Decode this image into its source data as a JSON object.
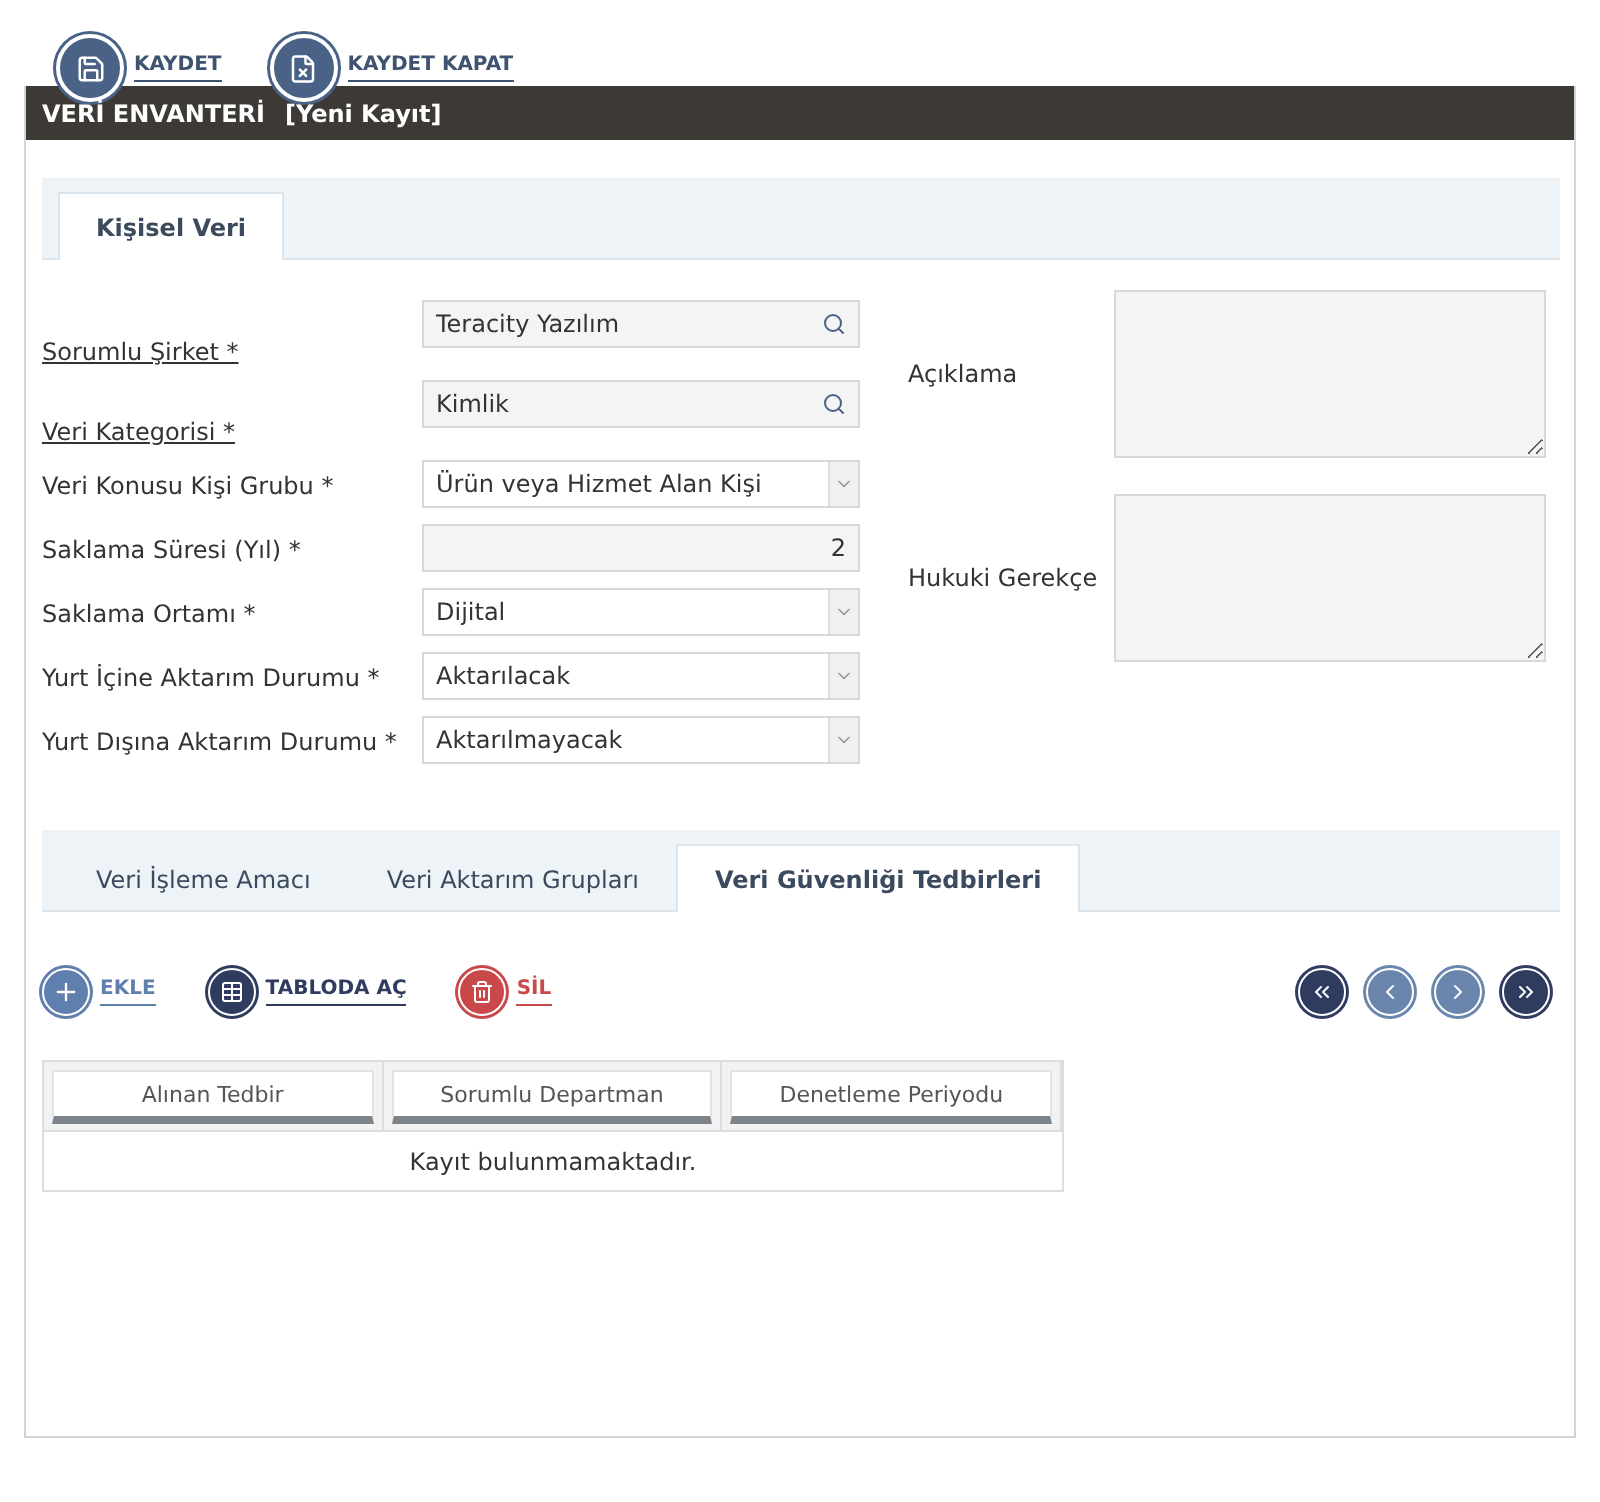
{
  "toolbar": [
    {
      "kind": "save",
      "label": "KAYDET"
    },
    {
      "kind": "save_close",
      "label": "KAYDET KAPAT"
    }
  ],
  "header": {
    "title": "VERİ ENVANTERİ",
    "subtitle": "[Yeni Kayıt]"
  },
  "top_tabs": [
    {
      "label": "Kişisel Veri",
      "selected": true
    }
  ],
  "fields": [
    {
      "label": "Sorumlu Şirket *",
      "kind": "lookup",
      "value": "Teracity Yazılım",
      "linked": true
    },
    {
      "label": "Veri Kategorisi *",
      "kind": "lookup",
      "value": "Kimlik",
      "linked": true
    },
    {
      "label": "Veri Konusu Kişi Grubu *",
      "kind": "select",
      "value": "Ürün veya Hizmet Alan Kişi",
      "linked": false
    },
    {
      "label": "Saklama Süresi (Yıl) *",
      "kind": "number",
      "value": "2",
      "linked": false
    },
    {
      "label": "Saklama Ortamı *",
      "kind": "select",
      "value": "Dijital",
      "linked": false
    },
    {
      "label": "Yurt İçine Aktarım Durumu *",
      "kind": "select",
      "value": "Aktarılacak",
      "linked": false
    },
    {
      "label": "Yurt Dışına Aktarım Durumu *",
      "kind": "select",
      "value": "Aktarılmayacak",
      "linked": false
    }
  ],
  "text_areas": [
    {
      "label": "Açıklama"
    },
    {
      "label": "Hukuki Gerekçe"
    }
  ],
  "sub_tabs": [
    {
      "label": "Veri İşleme Amacı",
      "selected": false
    },
    {
      "label": "Veri Aktarım Grupları",
      "selected": false
    },
    {
      "label": "Veri Güvenliği Tedbirleri",
      "selected": true
    }
  ],
  "grid_actions": [
    {
      "kind": "add",
      "label": "EKLE"
    },
    {
      "kind": "table",
      "label": "TABLODA AÇ"
    },
    {
      "kind": "delete",
      "label": "SİL"
    }
  ],
  "pager": [
    {
      "kind": "first",
      "disabled": false
    },
    {
      "kind": "prev",
      "disabled": true
    },
    {
      "kind": "next",
      "disabled": true
    },
    {
      "kind": "last",
      "disabled": false
    }
  ],
  "table": {
    "columns": [
      "Alınan Tedbir",
      "Sorumlu Departman",
      "Denetleme Periyodu"
    ],
    "empty_message": "Kayıt bulunmamaktadır."
  }
}
